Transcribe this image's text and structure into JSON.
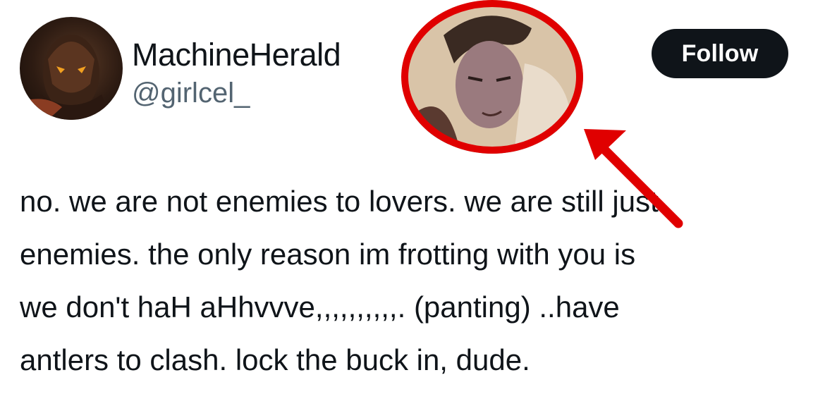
{
  "author": {
    "display_name": "MachineHerald",
    "handle": "@girlcel_"
  },
  "follow_button": {
    "label": "Follow"
  },
  "tweet": {
    "text": "no. we are not enemies to lovers. we are still just\nenemies. the only reason im frotting with you is\nwe don't haH aHhvvve,,,,,,,,,,. (panting) ..have\nantlers to clash. lock the buck in, dude."
  },
  "annotations": {
    "highlight_color": "#e00000",
    "icons": [
      "avatar-image",
      "highlighted-avatar-image",
      "red-arrow-icon"
    ]
  }
}
